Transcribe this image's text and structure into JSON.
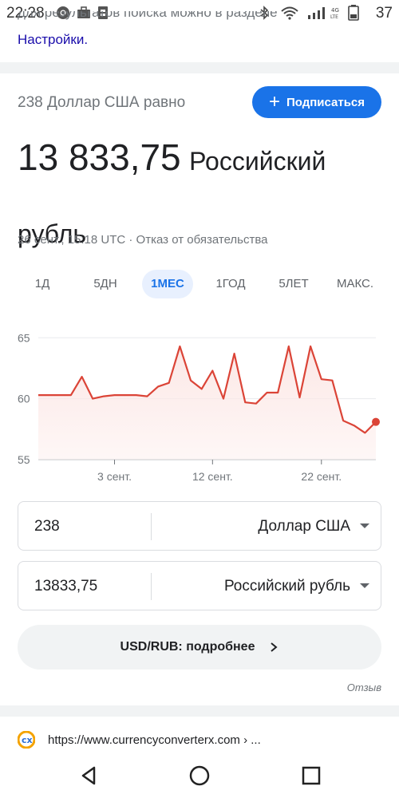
{
  "status_bar": {
    "time": "22:28",
    "battery": "37",
    "network": "4G LTE"
  },
  "top": {
    "cut_text": "для результатов поиска можно в разделе",
    "settings_link": "Настройки."
  },
  "converter": {
    "equals_line": "238 Доллар США равно",
    "subscribe_label": "Подписаться",
    "result_number": "13 833,75",
    "result_currency": "Российский рубль",
    "timestamp": "26 сент., 15:18 UTC · Отказ от обязательства",
    "tabs": [
      "1Д",
      "5ДН",
      "1МЕС",
      "1ГОД",
      "5ЛЕТ",
      "МАКС."
    ],
    "active_tab": "1МЕС",
    "from_value": "238",
    "from_unit": "Доллар США",
    "to_value": "13833,75",
    "to_unit": "Российский рубль",
    "more_label": "USD/RUB: подробнее",
    "feedback": "Отзыв"
  },
  "search_result": {
    "url": "https://www.currencyconverterx.com › ..."
  },
  "colors": {
    "accent": "#1a73e8",
    "line": "#db4437",
    "fill": "#fce8e6"
  },
  "chart_data": {
    "type": "area",
    "title": "",
    "xlabel": "",
    "ylabel": "",
    "y_ticks": [
      55,
      60,
      65
    ],
    "ylim": [
      55,
      66
    ],
    "x_tick_labels": [
      {
        "label": "3 сент.",
        "x": 3
      },
      {
        "label": "12 сент.",
        "x": 12
      },
      {
        "label": "22 сент.",
        "x": 22
      }
    ],
    "x_range": [
      -4,
      27
    ],
    "x": [
      -4,
      -2,
      -1,
      0,
      1,
      2,
      3,
      4,
      5,
      6,
      7,
      8,
      9,
      10,
      11,
      12,
      13,
      14,
      15,
      16,
      17,
      18,
      19,
      20,
      21,
      22,
      23,
      24,
      25,
      26,
      27
    ],
    "values": [
      60.3,
      60.3,
      60.3,
      61.8,
      60.0,
      60.2,
      60.3,
      60.3,
      60.3,
      60.2,
      61.0,
      61.3,
      64.3,
      61.5,
      60.8,
      62.3,
      60.0,
      63.7,
      59.7,
      59.6,
      60.5,
      60.5,
      64.3,
      60.1,
      64.3,
      61.6,
      61.5,
      58.2,
      57.8,
      57.2,
      58.1
    ]
  }
}
